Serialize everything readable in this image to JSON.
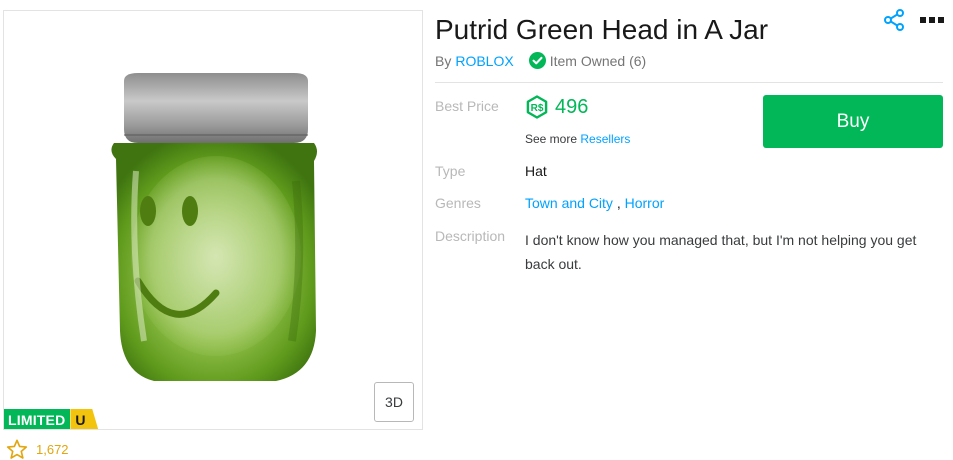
{
  "item": {
    "title": "Putrid Green Head in A Jar",
    "by_label": "By",
    "creator": "ROBLOX",
    "owned_text": "Item Owned (6)",
    "favorite_count": "1,672"
  },
  "thumbnail": {
    "view_3d_label": "3D",
    "limited_label": "LIMITED",
    "unique_label": "U"
  },
  "details": {
    "best_price_label": "Best Price",
    "price": "496",
    "currency_icon": "robux-icon",
    "see_more_text": "See more",
    "resellers_link": "Resellers",
    "buy_label": "Buy",
    "type_label": "Type",
    "type_value": "Hat",
    "genres_label": "Genres",
    "genres": [
      "Town and City",
      "Horror"
    ],
    "genre_separator": ",",
    "description_label": "Description",
    "description": "I don't know how you managed that, but I'm not helping you get back out."
  },
  "colors": {
    "accent_green": "#02b757",
    "link_blue": "#00a2ff",
    "limited_yellow": "#f2c40e",
    "favorite_gold": "#e2a60f"
  }
}
